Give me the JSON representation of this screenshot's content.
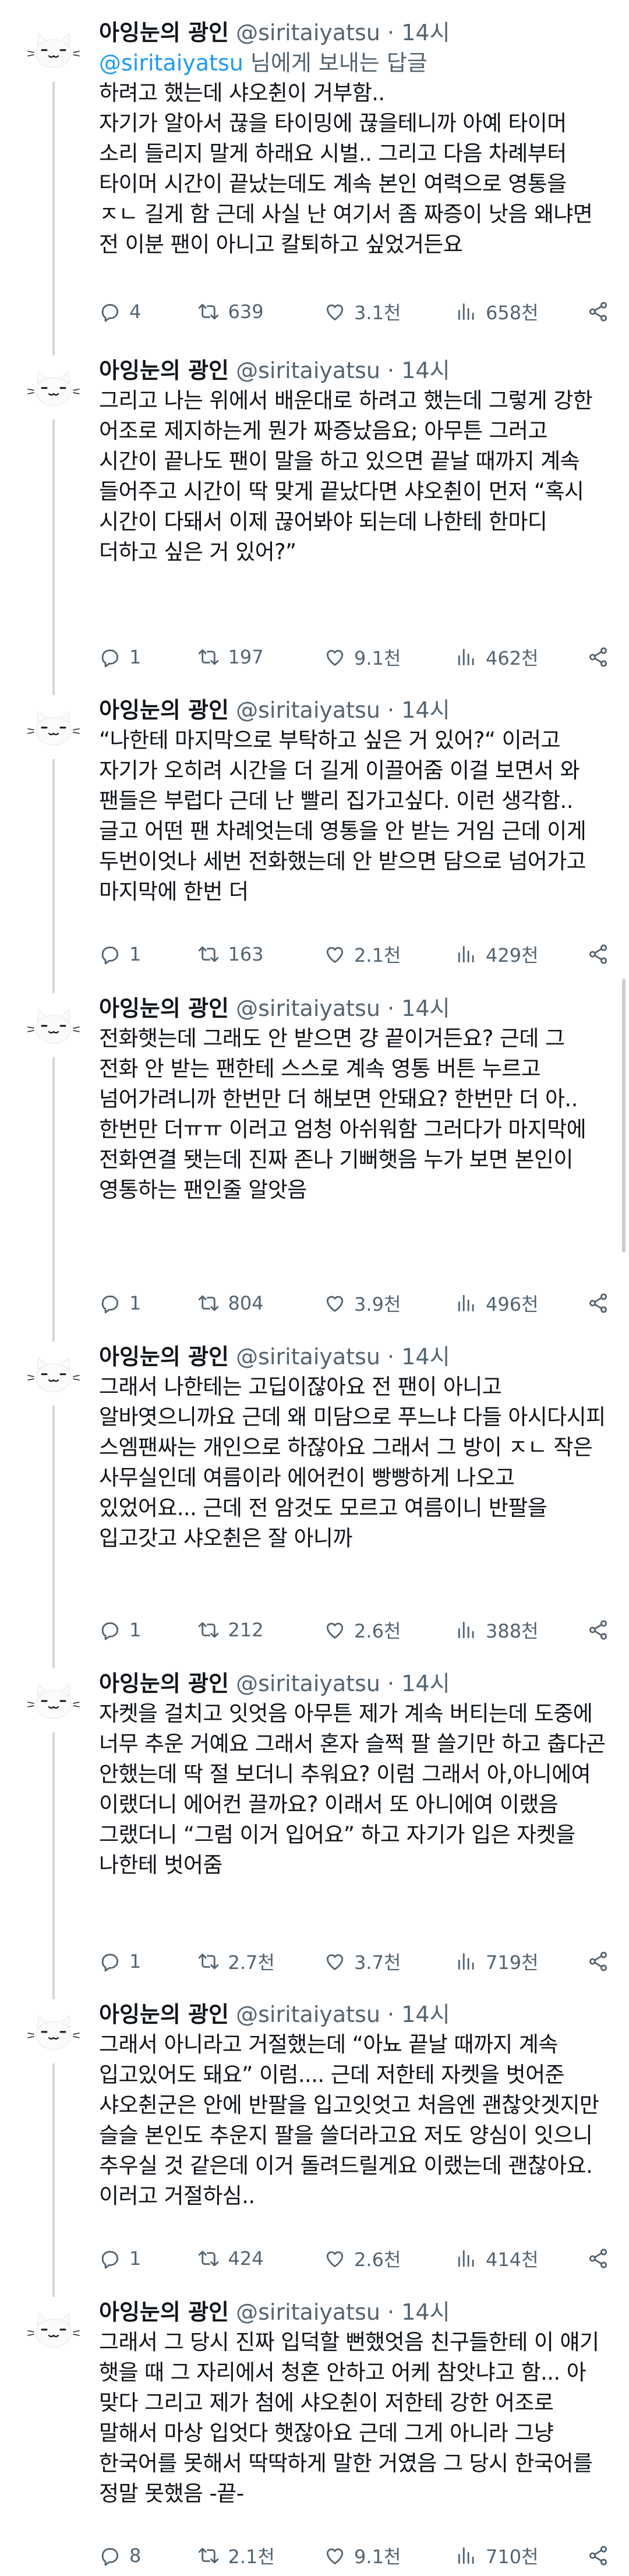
{
  "author": {
    "display_name": "아잉눈의 광인",
    "handle": "@siritaiyatsu",
    "separator": "·",
    "time": "14시"
  },
  "reply_to": {
    "mention": "@siritaiyatsu",
    "suffix": " 님에게 보내는 답글"
  },
  "tweets": [
    {
      "text": "하려고 했는데 샤오췬이 거부함..\n자기가 알아서 끊을 타이밍에 끊을테니까 아예 타이머 소리 들리지 말게 하래요 시벌.. 그리고 다음 차례부터 타이머 시간이 끝났는데도 계속 본인 여력으로 영통을 ㅈㄴ 길게 함 근데 사실 난 여기서 좀 짜증이 낫음 왜냐면 전 이분 팬이 아니고 칼퇴하고 싶었거든요",
      "replies": "4",
      "retweets": "639",
      "likes": "3.1천",
      "views": "658천"
    },
    {
      "text": "그리고 나는 위에서 배운대로 하려고 했는데 그렇게 강한 어조로 제지하는게 뭔가 짜증났음요; 아무튼 그러고 시간이 끝나도 팬이 말을 하고 있으면 끝날 때까지 계속 들어주고 시간이 딱 맞게 끝났다면 샤오췬이 먼저 “혹시 시간이 다돼서 이제 끊어봐야 되는데 나한테 한마디 더하고 싶은 거 있어?”",
      "replies": "1",
      "retweets": "197",
      "likes": "9.1천",
      "views": "462천"
    },
    {
      "text": "“나한테 마지막으로 부탁하고 싶은 거 있어?“ 이러고 자기가 오히려 시간을 더 길게 이끌어줌 이걸 보면서 와 팬들은 부럽다 근데 난 빨리 집가고싶다. 이런 생각함.. 글고 어떤 팬 차례엇는데 영통을 안 받는 거임 근데 이게 두번이엇나 세번 전화했는데 안 받으면 담으로 넘어가고 마지막에 한번 더",
      "replies": "1",
      "retweets": "163",
      "likes": "2.1천",
      "views": "429천"
    },
    {
      "text": "전화햇는데 그래도 안 받으면 걍 끝이거든요? 근데 그 전화 안 받는 팬한테 스스로 계속 영통 버튼 누르고 넘어가려니까 한번만 더 해보면 안돼요? 한번만 더 아.. 한번만 더ㅠㅠ 이러고 엄청 아쉬워함 그러다가 마지막에 전화연결 됏는데 진짜 존나 기뻐햇음 누가 보면 본인이 영통하는 팬인줄 알앗음",
      "replies": "1",
      "retweets": "804",
      "likes": "3.9천",
      "views": "496천"
    },
    {
      "text": "그래서 나한테는 고딥이잖아요 전 팬이 아니고 알바엿으니까요 근데 왜 미담으로 푸느냐 다들 아시다시피 스엠팬싸는 개인으로 하잖아요 그래서 그 방이 ㅈㄴ 작은 사무실인데 여름이라 에어컨이 빵빵하게 나오고 있었어요... 근데 전 암것도 모르고 여름이니 반팔을 입고갓고 샤오췬은 잘 아니까",
      "replies": "1",
      "retweets": "212",
      "likes": "2.6천",
      "views": "388천"
    },
    {
      "text": "자켓을 걸치고 잇엇음 아무튼 제가 계속 버티는데 도중에 너무 추운 거예요 그래서 혼자 슬쩍 팔 쓸기만 하고 춥다곤 안했는데 딱 절 보더니 추워요? 이럼 그래서 아,아니에여 이랬더니 에어컨 끌까요? 이래서 또 아니에여 이랬음 그랬더니 “그럼 이거 입어요” 하고 자기가 입은 자켓을 나한테 벗어줌",
      "replies": "1",
      "retweets": "2.7천",
      "likes": "3.7천",
      "views": "719천"
    },
    {
      "text": "그래서 아니라고 거절했는데 “아뇨 끝날 때까지 계속 입고있어도 돼요” 이럼.... 근데 저한테 자켓을 벗어준 샤오췬군은 안에 반팔을 입고잇엇고 처음엔 괜찮앗겟지만 슬슬 본인도 추운지 팔을 쓸더라고요 저도 양심이 잇으니 추우실 것 같은데 이거 돌려드릴게요 이랬는데 괜찮아요. 이러고 거절하심..",
      "replies": "1",
      "retweets": "424",
      "likes": "2.6천",
      "views": "414천"
    },
    {
      "text": "그래서 그 당시 진짜 입덕할 뻔했엇음 친구들한테 이 얘기 햇을 때 그 자리에서 청혼 안하고 어케 참앗냐고 함... 아 맞다 그리고 제가 첨에 샤오췬이 저한테 강한 어조로 말해서 마상 입엇다 햇잖아요 근데 그게 아니라 그냥 한국어를 못해서 딱딱하게 말한 거였음 그 당시 한국어를 정말 못했음 -끝-",
      "replies": "8",
      "retweets": "2.1천",
      "likes": "9.1천",
      "views": "710천"
    }
  ],
  "icons": {
    "reply": "reply-icon",
    "retweet": "retweet-icon",
    "like": "heart-icon",
    "views": "views-chart-icon",
    "share": "share-icon",
    "avatar": "white-cat-avatar"
  },
  "colors": {
    "text": "#0f1419",
    "secondary": "#536471",
    "link": "#1d9bf0",
    "thread_line": "#cfd9de",
    "background": "#ffffff"
  }
}
